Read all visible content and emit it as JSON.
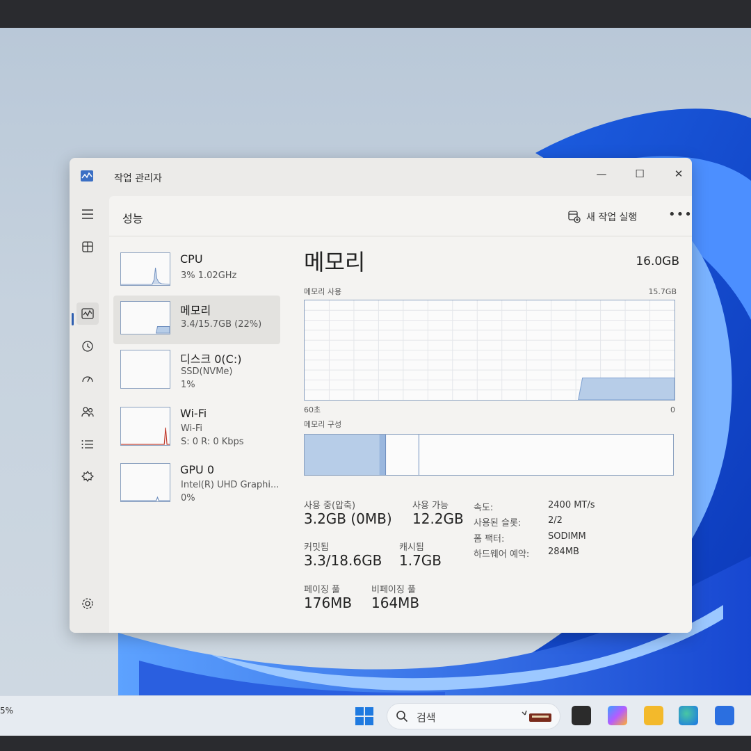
{
  "window": {
    "title": "작업 관리자",
    "controls": {
      "minimize": "—",
      "maximize": "☐",
      "close": "✕"
    }
  },
  "header": {
    "page_title": "성능",
    "run_new_task": "새 작업 실행",
    "more": "•••"
  },
  "nav": {
    "items": [
      "menu-icon",
      "processes-icon",
      "performance-icon",
      "app-history-icon",
      "startup-apps-icon",
      "users-icon",
      "details-icon",
      "services-icon",
      "settings-icon"
    ],
    "active": "performance"
  },
  "resources": [
    {
      "name": "CPU",
      "sub1": "3% 1.02GHz",
      "sub2": ""
    },
    {
      "name": "메모리",
      "sub1": "3.4/15.7GB (22%)",
      "sub2": ""
    },
    {
      "name": "디스크 0(C:)",
      "sub1": "SSD(NVMe)",
      "sub2": "1%"
    },
    {
      "name": "Wi-Fi",
      "sub1": "Wi-Fi",
      "sub2": "S: 0 R: 0 Kbps"
    },
    {
      "name": "GPU 0",
      "sub1": "Intel(R) UHD Graphi...",
      "sub2": "0%"
    }
  ],
  "detail": {
    "title": "메모리",
    "total": "16.0GB",
    "usage_label": "메모리 사용",
    "usage_max": "15.7GB",
    "graph_left": "60초",
    "graph_right": "0",
    "composition_label": "메모리 구성",
    "usage_fraction": 0.22,
    "stats": {
      "in_use_label": "사용 중(압축)",
      "in_use_value": "3.2GB (0MB)",
      "available_label": "사용 가능",
      "available_value": "12.2GB",
      "committed_label": "커밋됨",
      "committed_value": "3.3/18.6GB",
      "cached_label": "캐시됨",
      "cached_value": "1.7GB",
      "paged_label": "페이징 풀",
      "paged_value": "176MB",
      "nonpaged_label": "비페이징 풀",
      "nonpaged_value": "164MB"
    },
    "specs": {
      "speed_key": "속도:",
      "speed_val": "2400 MT/s",
      "slots_key": "사용된 슬롯:",
      "slots_val": "2/2",
      "form_key": "폼 팩터:",
      "form_val": "SODIMM",
      "reserved_key": "하드웨어 예약:",
      "reserved_val": "284MB"
    }
  },
  "taskbar": {
    "search_placeholder": "검색",
    "tray_fragment": "5%"
  },
  "colors": {
    "accent": "#2f5fb0",
    "graph_fill": "#b7cde8",
    "graph_line": "#7b9fd0"
  }
}
